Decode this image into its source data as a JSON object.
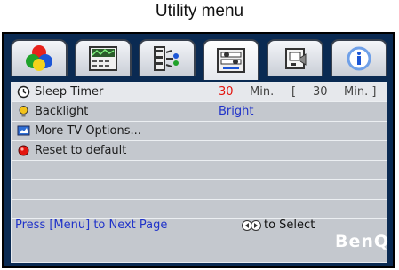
{
  "caption": "Utility menu",
  "tabs": [
    {
      "name": "picture-tab",
      "icon": "color-palette-icon"
    },
    {
      "name": "display-tab",
      "icon": "display-settings-icon"
    },
    {
      "name": "input-tab",
      "icon": "input-source-icon"
    },
    {
      "name": "utility-tab",
      "icon": "utility-icon",
      "active": true
    },
    {
      "name": "installation-tab",
      "icon": "installation-icon"
    },
    {
      "name": "information-tab",
      "icon": "info-icon"
    }
  ],
  "menu": {
    "items": [
      {
        "label": "Sleep Timer",
        "icon": "clock-icon",
        "value": "30",
        "unit": "Min.",
        "bracket_open": "[",
        "current": "30",
        "bracket_close": "Min. ]"
      },
      {
        "label": "Backlight",
        "icon": "lightbulb-icon",
        "value": "Bright"
      },
      {
        "label": "More TV Options...",
        "icon": "tv-options-icon"
      },
      {
        "label": "Reset to default",
        "icon": "reset-icon"
      }
    ]
  },
  "footer": {
    "hint_left": "Press [Menu] to Next Page",
    "hint_right": "to Select",
    "brand": "BenQ"
  },
  "colors": {
    "osd_frame": "#0a2a52",
    "panel": "#c4c8ce",
    "value_red": "#e3150f",
    "value_blue": "#2033c9"
  }
}
